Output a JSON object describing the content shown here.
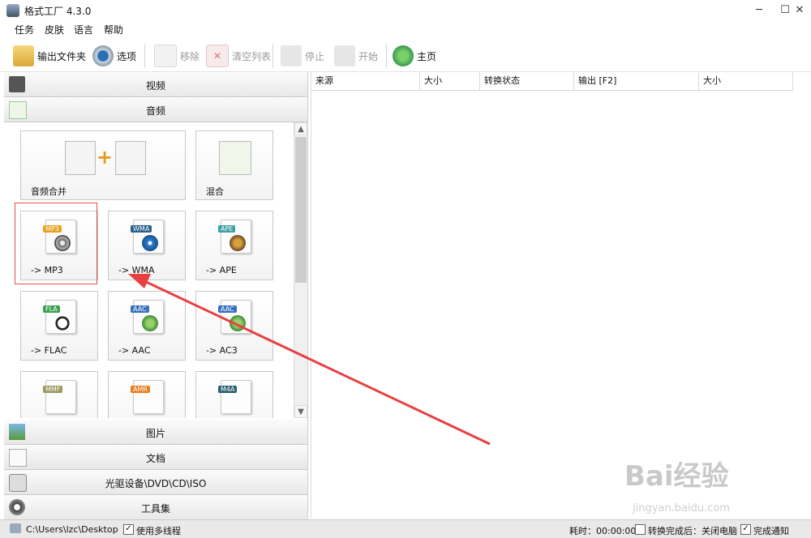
{
  "window": {
    "title": "格式工厂 4.3.0"
  },
  "menu": [
    "任务",
    "皮肤",
    "语言",
    "帮助"
  ],
  "toolbar": {
    "output_folder": "输出文件夹",
    "options": "选项",
    "remove": "移除",
    "clear_list": "清空列表",
    "stop": "停止",
    "start": "开始",
    "home": "主页"
  },
  "categories": {
    "video": "视频",
    "audio": "音频",
    "picture": "图片",
    "document": "文档",
    "optical": "光驱设备\\DVD\\CD\\ISO",
    "tools": "工具集"
  },
  "tiles": [
    {
      "label": "音频合并",
      "icon": "audio-merge-icon"
    },
    {
      "label": "混合",
      "icon": "audio-mix-icon"
    },
    {
      "label": "-> MP3",
      "tag": "MP3",
      "tag_color": "#e8a020"
    },
    {
      "label": "-> WMA",
      "tag": "WMA",
      "tag_color": "#2a5f8a"
    },
    {
      "label": "-> APE",
      "tag": "APE",
      "tag_color": "#3aa0a0"
    },
    {
      "label": "-> FLAC",
      "tag": "FLA",
      "tag_color": "#3aa050"
    },
    {
      "label": "-> AAC",
      "tag": "AAC",
      "tag_color": "#3a70c0"
    },
    {
      "label": "-> AC3",
      "tag": "AAC",
      "tag_color": "#3a70c0"
    },
    {
      "label": "",
      "tag": "MMF",
      "tag_color": "#9a9a60"
    },
    {
      "label": "",
      "tag": "AMR",
      "tag_color": "#e88020"
    },
    {
      "label": "",
      "tag": "M4A",
      "tag_color": "#2a6070"
    }
  ],
  "grid": {
    "columns": [
      "来源",
      "大小",
      "转换状态",
      "输出 [F2]",
      "大小"
    ]
  },
  "status": {
    "path": "C:\\Users\\lzc\\Desktop",
    "multithread": "使用多线程",
    "multithread_checked": true,
    "elapsed": "耗时：00:00:00",
    "after_done": "转换完成后：关闭电脑",
    "after_done_checked": false,
    "notify": "完成通知",
    "notify_checked": true
  },
  "watermark": {
    "brand": "Bai经验",
    "url": "jingyan.baidu.com"
  }
}
